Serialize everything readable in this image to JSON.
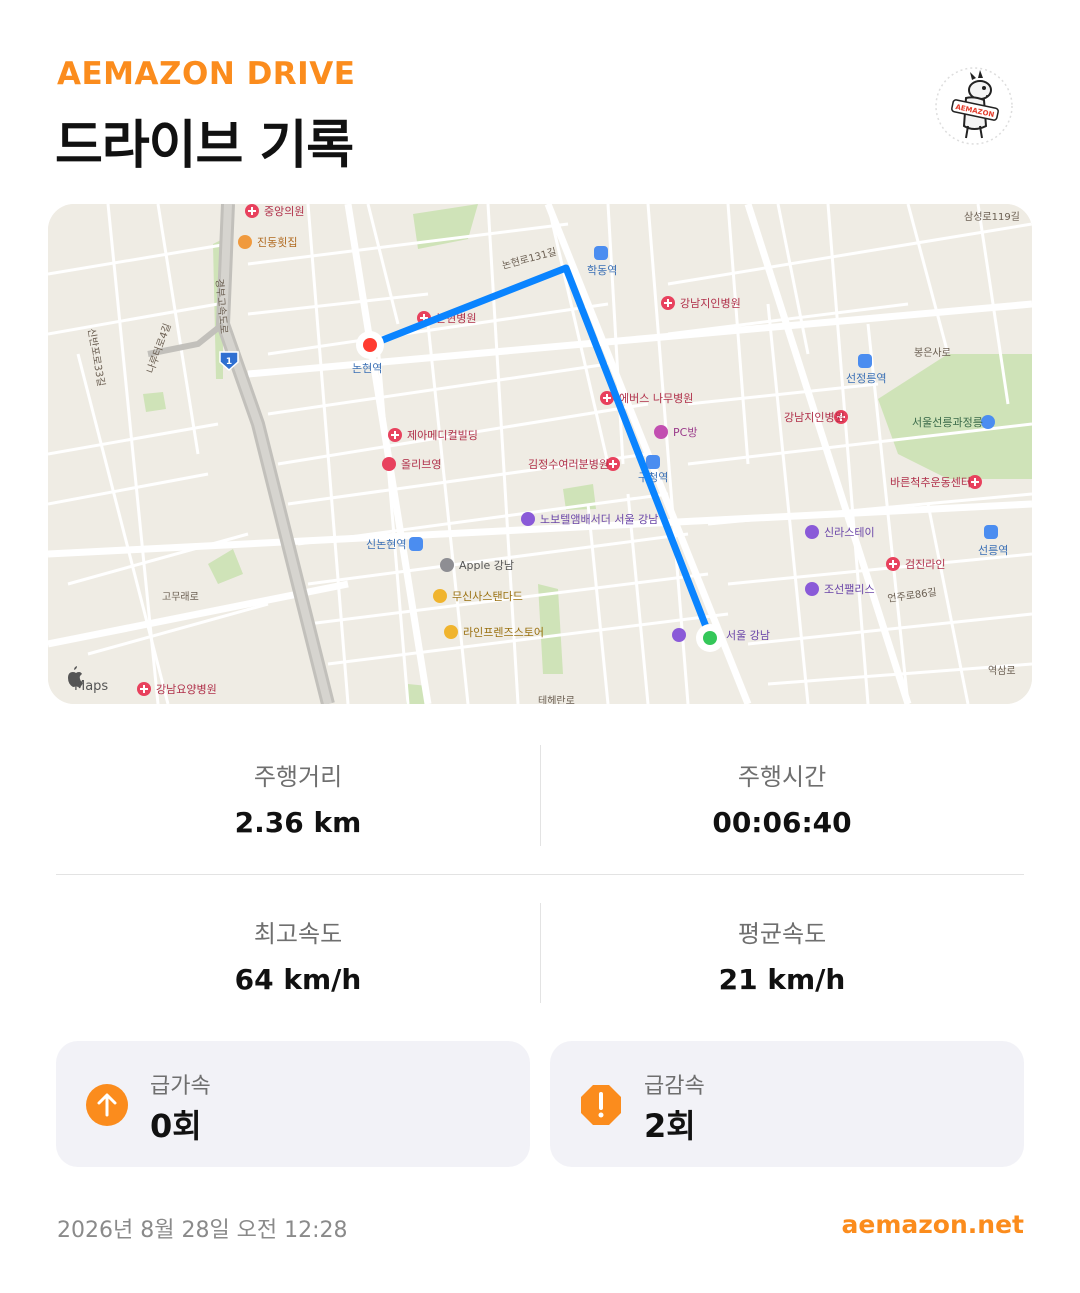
{
  "header": {
    "brand": "AEMAZON DRIVE",
    "title": "드라이브 기록",
    "logo_text": "AEMAZON"
  },
  "map": {
    "attribution": "Maps",
    "route_color": "#0a84ff",
    "start_color": "#ff3b30",
    "end_color": "#34c759",
    "labels": {
      "station_nonhyeon": "논현역",
      "station_hakdong": "학동역",
      "station_seonjeongneung": "선정릉역",
      "station_sinnonhyeon": "신논현역",
      "station_seolleung": "선릉역",
      "station_gangnamgu": "구청역",
      "poi_jungang": "중앙의원",
      "poi_jindong": "진동횟집",
      "poi_hospital_a": "논현병원",
      "poi_gangnamjiin": "강남지인병원",
      "poi_namu": "에버스 나무병원",
      "poi_pc": "PC방",
      "poi_jeamedical": "제아메디컬빌딩",
      "poi_olive": "올리브영",
      "poi_gimjeong": "김정수여러분병원",
      "poi_novotel": "노보텔앰배서더 서울 강남",
      "poi_apple": "Apple 강남",
      "poi_musinsa": "무신사스탠다드",
      "poi_linefriends": "라인프렌즈스토어",
      "poi_gangnamjiin2": "강남지인병원",
      "poi_seolleung_park": "서울선릉과정릉",
      "poi_bareun": "바른척추운동센터",
      "poi_shilla": "신라스테이",
      "poi_geomjin": "검진라인",
      "poi_joseon": "조선팰리스",
      "poi_hotel_end": "서울 강남",
      "poi_yoyang": "강남요양병원",
      "road_samseong": "삼성로119길",
      "road_bongeun": "봉은사로",
      "road_nonhyeon131": "논현로131길",
      "road_sinbanpo": "신반포로33길",
      "road_naruteo": "나루터로4길",
      "road_gyeongbu": "경부고속도로",
      "road_goomae": "고무래로",
      "road_eonju": "언주로86길",
      "road_yeoksam": "역삼로",
      "road_teheran": "테헤란로",
      "highway_shield": "1"
    }
  },
  "stats": {
    "distance_label": "주행거리",
    "distance_value": "2.36 km",
    "time_label": "주행시간",
    "time_value": "00:06:40",
    "max_speed_label": "최고속도",
    "max_speed_value": "64 km/h",
    "avg_speed_label": "평균속도",
    "avg_speed_value": "21 km/h"
  },
  "events": {
    "accel_label": "급가속",
    "accel_value": "0회",
    "accel_icon": "arrow-up-icon",
    "decel_label": "급감속",
    "decel_value": "2회",
    "decel_icon": "warning-octagon-icon",
    "accent_color": "#fb8c1d"
  },
  "footer": {
    "date": "2026년 8월 28일 오전 12:28",
    "url": "aemazon.net"
  }
}
